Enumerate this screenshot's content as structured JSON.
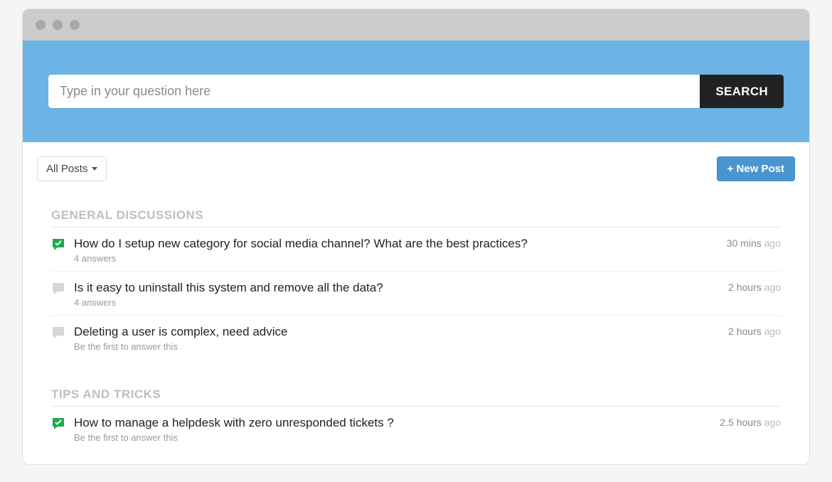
{
  "search": {
    "placeholder": "Type in your question here",
    "button_label": "SEARCH"
  },
  "toolbar": {
    "filter_label": "All Posts",
    "new_post_label": "+ New Post"
  },
  "time_suffix": "ago",
  "sections": [
    {
      "title": "GENERAL DISCUSSIONS",
      "posts": [
        {
          "icon": "answered",
          "title": "How do I setup new category for social media channel? What are the best practices?",
          "sub": "4 answers",
          "time_value": "30 mins"
        },
        {
          "icon": "unanswered",
          "title": "Is it easy to uninstall this system and remove all the data?",
          "sub": "4 answers",
          "time_value": "2 hours"
        },
        {
          "icon": "unanswered",
          "title": "Deleting a user is complex, need advice",
          "sub": "Be the first to answer this",
          "time_value": "2 hours"
        }
      ]
    },
    {
      "title": "TIPS AND TRICKS",
      "posts": [
        {
          "icon": "answered",
          "title": "How to manage a helpdesk with zero unresponded tickets ?",
          "sub": "Be the first to answer this",
          "time_value": "2.5 hours"
        }
      ]
    }
  ]
}
